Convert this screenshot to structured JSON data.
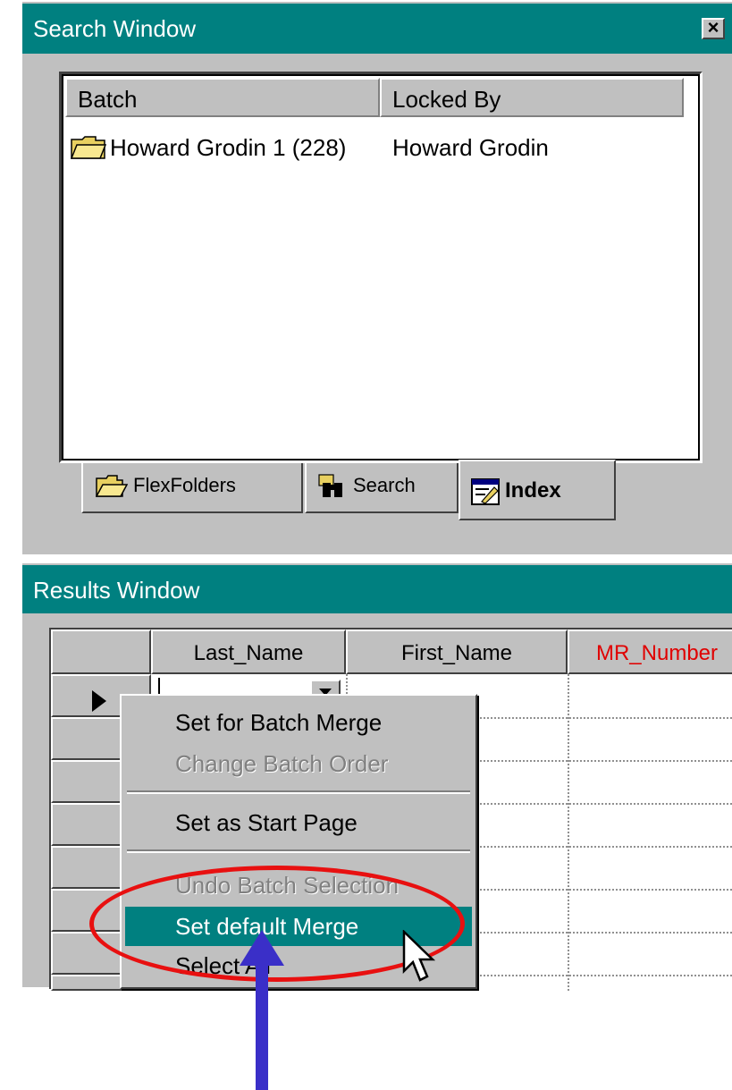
{
  "search_window": {
    "title": "Search Window",
    "close_glyph": "×",
    "columns": [
      "Batch",
      "Locked By"
    ],
    "rows": [
      {
        "batch": "Howard Grodin 1 (228)",
        "locked_by": "Howard Grodin",
        "icon": "folder-icon"
      }
    ],
    "tabs": [
      {
        "label": "FlexFolders",
        "icon": "open-folder-icon",
        "active": false
      },
      {
        "label": "Search",
        "icon": "binoculars-icon",
        "active": false
      },
      {
        "label": "Index",
        "icon": "index-edit-icon",
        "active": true
      }
    ]
  },
  "results_window": {
    "title": "Results Window",
    "columns": [
      "",
      "Last_Name",
      "First_Name",
      "MR_Number"
    ],
    "mr_number_color": "#e00000"
  },
  "context_menu": {
    "items": [
      {
        "label": "Set for Batch Merge",
        "enabled": true
      },
      {
        "label": "Change Batch Order",
        "enabled": false
      },
      {
        "label": "Set as Start Page",
        "enabled": true
      },
      {
        "label": "Undo Batch Selection",
        "enabled": false
      },
      {
        "label": "Set default Merge",
        "enabled": true,
        "highlighted": true
      },
      {
        "label": "Select All",
        "enabled": true
      }
    ]
  },
  "colors": {
    "titlebar": "#008080",
    "highlight_ellipse": "#e81010",
    "arrow": "#3a2fc8"
  }
}
